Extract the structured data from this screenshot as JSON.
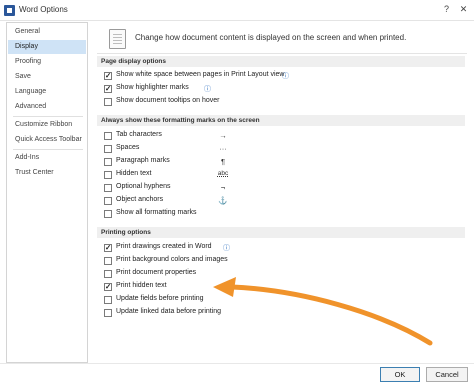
{
  "window": {
    "title": "Word Options",
    "help_glyph": "?",
    "close_glyph": "✕"
  },
  "sidebar": {
    "items": [
      {
        "label": "General",
        "selected": false
      },
      {
        "label": "Display",
        "selected": true
      },
      {
        "label": "Proofing",
        "selected": false
      },
      {
        "label": "Save",
        "selected": false
      },
      {
        "label": "Language",
        "selected": false
      },
      {
        "label": "Advanced",
        "selected": false
      },
      {
        "label": "Customize Ribbon",
        "selected": false
      },
      {
        "label": "Quick Access Toolbar",
        "selected": false
      },
      {
        "label": "Add-Ins",
        "selected": false
      },
      {
        "label": "Trust Center",
        "selected": false
      }
    ]
  },
  "header": {
    "text": "Change how document content is displayed on the screen and when printed."
  },
  "sections": {
    "page_display": {
      "title": "Page display options",
      "options": [
        {
          "label": "Show white space between pages in Print Layout view",
          "checked": true,
          "info": "ⓘ"
        },
        {
          "label": "Show highlighter marks",
          "checked": true,
          "info": "ⓘ"
        },
        {
          "label": "Show document tooltips on hover",
          "checked": false
        }
      ]
    },
    "formatting_marks": {
      "title": "Always show these formatting marks on the screen",
      "options": [
        {
          "label": "Tab characters",
          "checked": false,
          "mark": "→"
        },
        {
          "label": "Spaces",
          "checked": false,
          "mark": "···"
        },
        {
          "label": "Paragraph marks",
          "checked": false,
          "mark": "¶"
        },
        {
          "label": "Hidden text",
          "checked": false,
          "mark": "abc"
        },
        {
          "label": "Optional hyphens",
          "checked": false,
          "mark": "¬"
        },
        {
          "label": "Object anchors",
          "checked": false,
          "mark": "⚓"
        },
        {
          "label": "Show all formatting marks",
          "checked": false
        }
      ]
    },
    "printing": {
      "title": "Printing options",
      "options": [
        {
          "label": "Print drawings created in Word",
          "checked": true,
          "info": "ⓘ"
        },
        {
          "label": "Print background colors and images",
          "checked": false
        },
        {
          "label": "Print document properties",
          "checked": false
        },
        {
          "label": "Print hidden text",
          "checked": true
        },
        {
          "label": "Update fields before printing",
          "checked": false
        },
        {
          "label": "Update linked data before printing",
          "checked": false
        }
      ]
    }
  },
  "footer": {
    "ok_label": "OK",
    "cancel_label": "Cancel"
  },
  "colors": {
    "accent": "#2b579a",
    "selection": "#cfe3f6",
    "annotation_arrow": "#f0932b"
  }
}
